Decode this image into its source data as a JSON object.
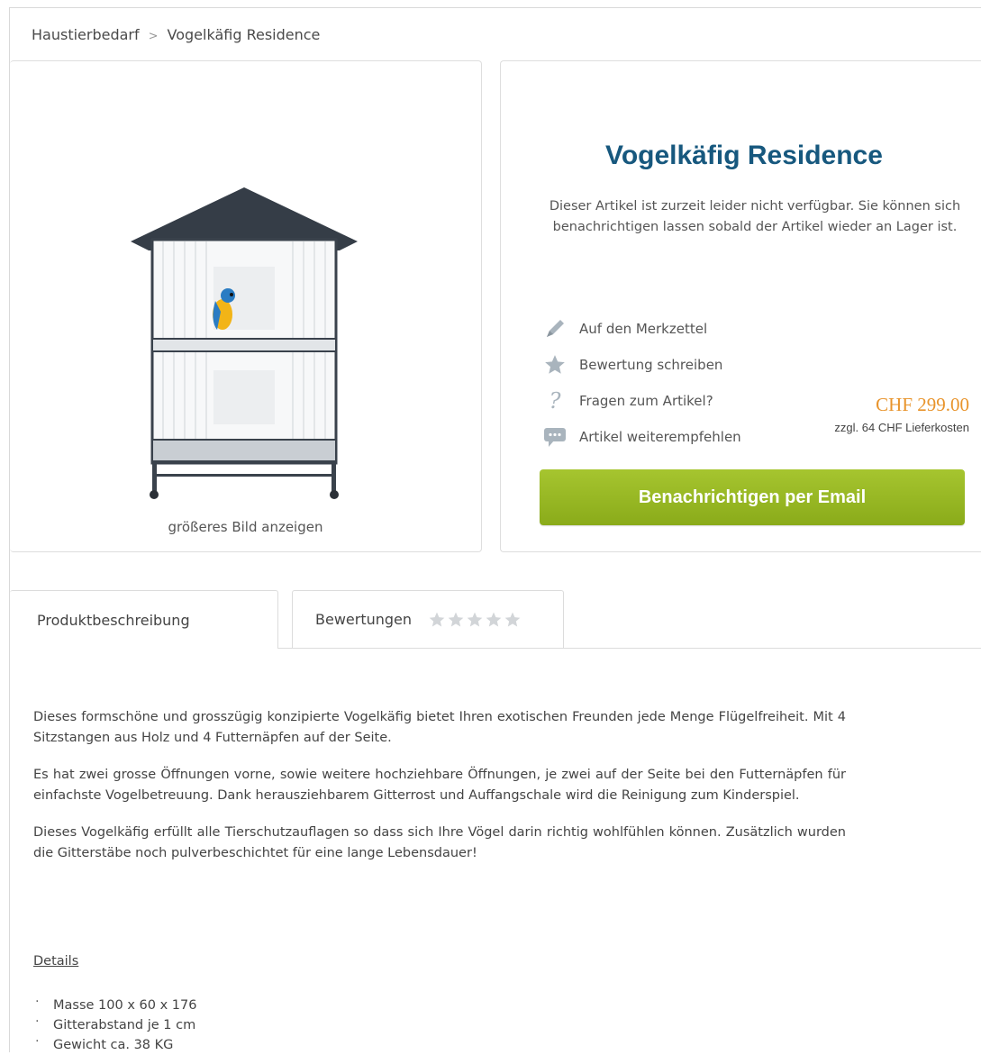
{
  "breadcrumb": {
    "home": "Haustierbedarf",
    "separator": ">",
    "current": "Vogelkäfig Residence"
  },
  "product": {
    "title": "Vogelkäfig Residence",
    "availability_text": "Dieser Artikel ist zurzeit leider nicht verfügbar. Sie können sich benachrichtigen lassen sobald der Artikel wieder an Lager ist.",
    "image_link": "größeres Bild anzeigen",
    "price": "CHF 299.00",
    "shipping": "zzgl. 64 CHF Lieferkosten",
    "notify_button": "Benachrichtigen per Email"
  },
  "actions": [
    {
      "label": "Auf den Merkzettel",
      "icon": "pencil-icon"
    },
    {
      "label": "Bewertung schreiben",
      "icon": "star-icon"
    },
    {
      "label": "Fragen zum Artikel?",
      "icon": "question-icon"
    },
    {
      "label": "Artikel weiterempfehlen",
      "icon": "speech-bubble-icon"
    }
  ],
  "tabs": {
    "description": "Produktbeschreibung",
    "reviews": "Bewertungen",
    "rating_stars": 0,
    "rating_max": 5
  },
  "description": {
    "p1": "Dieses formschöne und grosszügig konzipierte Vogelkäfig bietet Ihren exotischen Freunden jede Menge Flügelfreiheit. Mit 4 Sitzstangen aus Holz und 4 Futternäpfen auf der Seite.",
    "p2": "Es hat zwei grosse Öffnungen vorne, sowie weitere hochziehbare Öffnungen, je zwei auf der Seite bei den Futternäpfen für einfachste Vogelbetreuung. Dank herausziehbarem Gitterrost und Auffangschale wird die Reinigung zum Kinderspiel.",
    "p3": "Dieses Vogelkäfig erfüllt alle Tierschutzauflagen so dass sich Ihre Vögel darin richtig wohlfühlen können. Zusätzlich wurden die Gitterstäbe noch pulverbeschichtet für eine lange Lebensdauer!"
  },
  "details": {
    "heading": "Details",
    "items": [
      "Masse 100 x 60 x 176",
      "Gitterabstand je 1 cm",
      "Gewicht ca. 38 KG"
    ]
  },
  "colors": {
    "title": "#17587e",
    "price": "#e8942c",
    "button": "#98b724",
    "icon": "#a9b4bd"
  }
}
